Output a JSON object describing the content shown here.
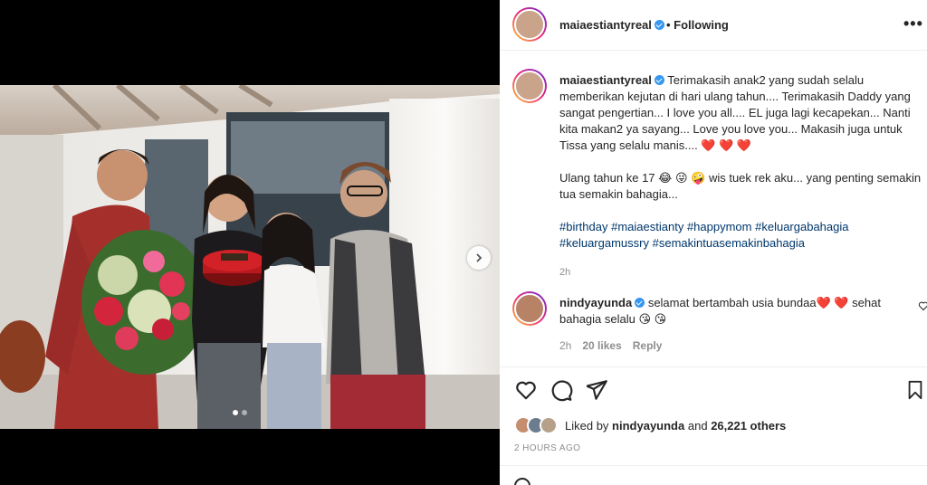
{
  "post": {
    "username": "maiaestiantyreal",
    "follow_status": "Following",
    "caption_text": "Terimakasih anak2 yang sudah selalu memberikan kejutan di hari ulang tahun.... Terimakasih Daddy yang sangat pengertian... I love you all.... EL juga lagi kecapekan... Nanti kita makan2 ya sayang... Love you love you... Makasih juga untuk Tissa yang selalu manis....",
    "caption_hearts": "❤️ ❤️ ❤️",
    "caption_line2_a": "Ulang tahun ke 17",
    "caption_line2_emoji": "😂 😜 🤪",
    "caption_line2_b": "wis tuek rek aku... yang penting semakin tua semakin bahagia...",
    "hashtags": [
      "#birthday",
      "#maiaestianty",
      "#happymom",
      "#keluargabahagia",
      "#keluargamussry",
      "#semakintuasemakinbahagia"
    ],
    "caption_time": "2h"
  },
  "comment": {
    "username": "nindyayunda",
    "text_a": "selamat bertambah usia bundaa",
    "hearts": "❤️ ❤️",
    "text_b": "sehat bahagia selalu",
    "emoji": "😘 😘",
    "time": "2h",
    "likes": "20 likes",
    "reply": "Reply"
  },
  "likes": {
    "prefix": "Liked by",
    "user": "nindyayunda",
    "middle": "and",
    "count": "26,221 others"
  },
  "date": "2 HOURS AGO",
  "icons": {
    "more": "more-options-icon",
    "heart": "heart-icon",
    "comment": "comment-icon",
    "share": "share-icon",
    "save": "bookmark-icon",
    "next": "chevron-right-icon",
    "verified": "verified-badge-icon"
  },
  "carousel": {
    "slide_count": 2,
    "current": 1
  }
}
